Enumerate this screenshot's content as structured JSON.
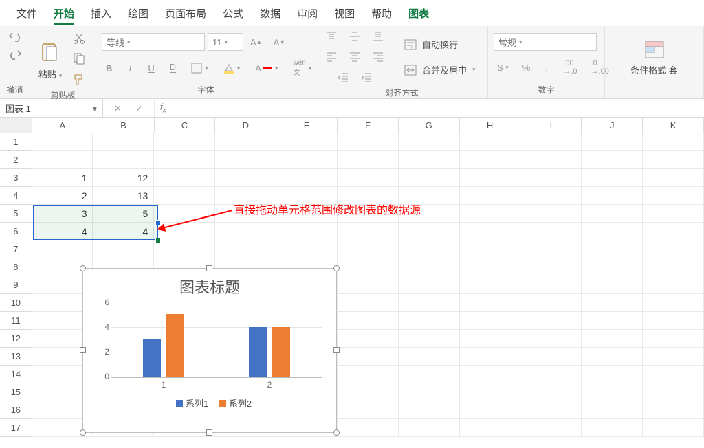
{
  "tabs": [
    "文件",
    "开始",
    "插入",
    "绘图",
    "页面布局",
    "公式",
    "数据",
    "审阅",
    "视图",
    "帮助",
    "图表"
  ],
  "active_tab": "开始",
  "tool_tab": "图表",
  "groups": {
    "undo": "撤消",
    "clipboard": "剪贴板",
    "font": "字体",
    "align": "对齐方式",
    "number": "数字",
    "cond": "条件格式 套"
  },
  "clipboard_paste": "粘贴",
  "font": {
    "name": "等线",
    "size": "11"
  },
  "align": {
    "wrap": "自动换行",
    "merge": "合并及居中"
  },
  "number_format": "常规",
  "namebox": "图表 1",
  "columns": [
    "A",
    "B",
    "C",
    "D",
    "E",
    "F",
    "G",
    "H",
    "I",
    "J",
    "K"
  ],
  "rows": [
    "1",
    "2",
    "3",
    "4",
    "5",
    "6",
    "7",
    "8",
    "9",
    "10",
    "11",
    "12",
    "13",
    "14",
    "15",
    "16",
    "17"
  ],
  "cells": {
    "A3": "1",
    "B3": "12",
    "A4": "2",
    "B4": "13",
    "A5": "3",
    "B5": "5",
    "A6": "4",
    "B6": "4"
  },
  "annotation": "直接拖动单元格范围修改图表的数据源",
  "chart_data": {
    "type": "bar",
    "title": "图表标题",
    "categories": [
      "1",
      "2"
    ],
    "series": [
      {
        "name": "系列1",
        "values": [
          3,
          4
        ],
        "color": "#4472c4"
      },
      {
        "name": "系列2",
        "values": [
          5,
          4
        ],
        "color": "#ed7d31"
      }
    ],
    "yticks": [
      0,
      2,
      4,
      6
    ],
    "ylim": [
      0,
      6
    ]
  }
}
